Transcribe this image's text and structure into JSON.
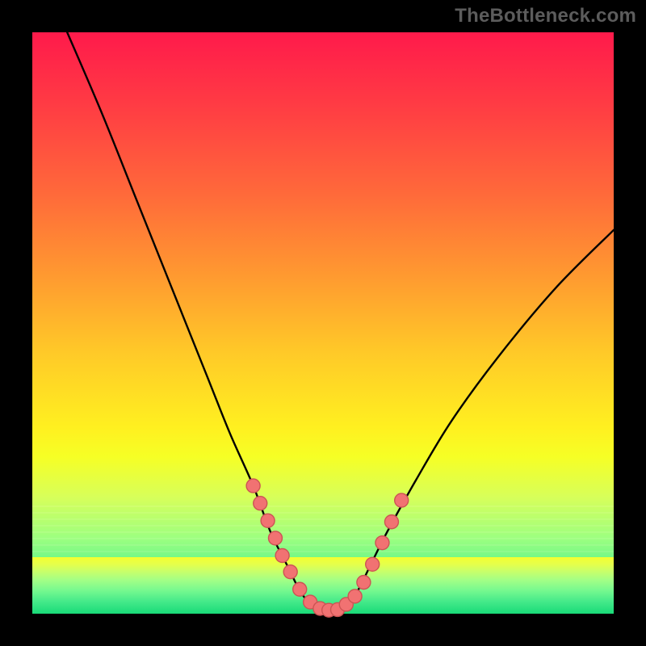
{
  "watermark": "TheBottleneck.com",
  "chart_data": {
    "type": "line",
    "title": "",
    "xlabel": "",
    "ylabel": "",
    "xlim": [
      0,
      100
    ],
    "ylim": [
      0,
      100
    ],
    "series": [
      {
        "name": "bottleneck-curve",
        "x": [
          6,
          12,
          18,
          24,
          30,
          34,
          38,
          41,
          44,
          46,
          48,
          50,
          52,
          54,
          56,
          58,
          61,
          66,
          72,
          80,
          90,
          100
        ],
        "y": [
          100,
          86,
          71,
          56,
          41,
          31,
          22,
          14,
          8,
          4,
          1.5,
          0.5,
          0.5,
          1.5,
          4,
          8,
          14,
          23,
          33,
          44,
          56,
          66
        ]
      }
    ],
    "markers": [
      {
        "x": 38.0,
        "y": 22.0
      },
      {
        "x": 39.2,
        "y": 19.0
      },
      {
        "x": 40.5,
        "y": 16.0
      },
      {
        "x": 41.8,
        "y": 13.0
      },
      {
        "x": 43.0,
        "y": 10.0
      },
      {
        "x": 44.4,
        "y": 7.2
      },
      {
        "x": 46.0,
        "y": 4.2
      },
      {
        "x": 47.8,
        "y": 2.0
      },
      {
        "x": 49.5,
        "y": 0.9
      },
      {
        "x": 51.0,
        "y": 0.6
      },
      {
        "x": 52.5,
        "y": 0.7
      },
      {
        "x": 54.0,
        "y": 1.6
      },
      {
        "x": 55.5,
        "y": 3.0
      },
      {
        "x": 57.0,
        "y": 5.4
      },
      {
        "x": 58.5,
        "y": 8.5
      },
      {
        "x": 60.2,
        "y": 12.2
      },
      {
        "x": 61.8,
        "y": 15.8
      },
      {
        "x": 63.5,
        "y": 19.5
      }
    ],
    "background_gradient": {
      "top": "#ff1a4b",
      "bottom": "#18da78"
    },
    "curve_color": "#000000",
    "marker_color": "#f17272",
    "marker_stroke": "#cc5454"
  }
}
